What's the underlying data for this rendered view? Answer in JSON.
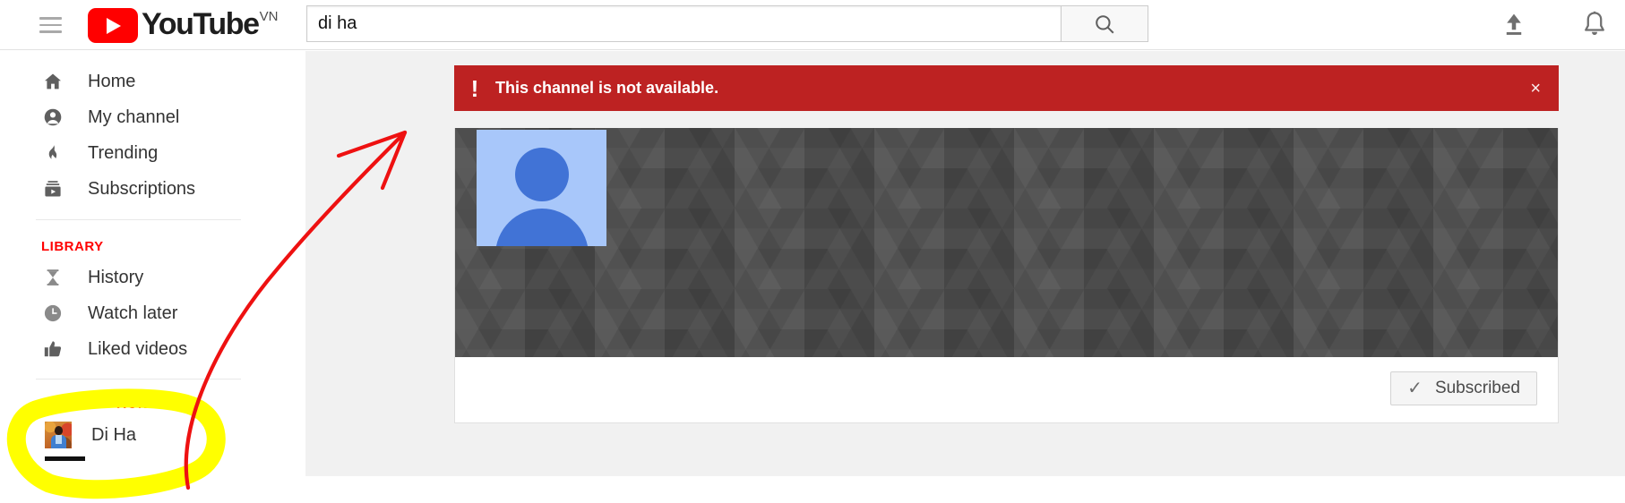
{
  "header": {
    "menu_icon": "hamburger-menu-icon",
    "logo_text": "YouTube",
    "logo_country": "VN",
    "logo_icon": "youtube-play-icon",
    "search": {
      "value": "di ha",
      "placeholder": "Search",
      "button_icon": "search-icon"
    },
    "upload_icon": "upload-icon",
    "notifications_icon": "notification-bell-icon"
  },
  "sidebar": {
    "main_items": [
      {
        "label": "Home",
        "icon": "home-icon"
      },
      {
        "label": "My channel",
        "icon": "account-circle-icon"
      },
      {
        "label": "Trending",
        "icon": "trending-flame-icon"
      },
      {
        "label": "Subscriptions",
        "icon": "subscriptions-icon"
      }
    ],
    "library": {
      "heading": "LIBRARY",
      "items": [
        {
          "label": "History",
          "icon": "history-hourglass-icon"
        },
        {
          "label": "Watch later",
          "icon": "clock-icon"
        },
        {
          "label": "Liked videos",
          "icon": "thumbs-up-icon"
        }
      ]
    },
    "subscriptions": {
      "heading": "SUBSCRIPTIONS",
      "items": [
        {
          "label": "Di Ha",
          "icon": "channel-avatar-thumbnail"
        }
      ]
    }
  },
  "alert": {
    "icon": "exclamation-icon",
    "message": "This channel is not available.",
    "close_label": "×",
    "background_color": "#bd2222"
  },
  "channel": {
    "banner_icon": "channel-banner-pattern",
    "avatar_icon": "default-person-avatar-icon",
    "subscribe_button": {
      "label": "Subscribed",
      "icon": "check-icon"
    }
  },
  "annotations": {
    "arrow_color": "#ee1111",
    "highlight_color": "#ffff00",
    "arrow_name": "red-arrow-annotation",
    "highlight_name": "yellow-highlight-annotation"
  }
}
